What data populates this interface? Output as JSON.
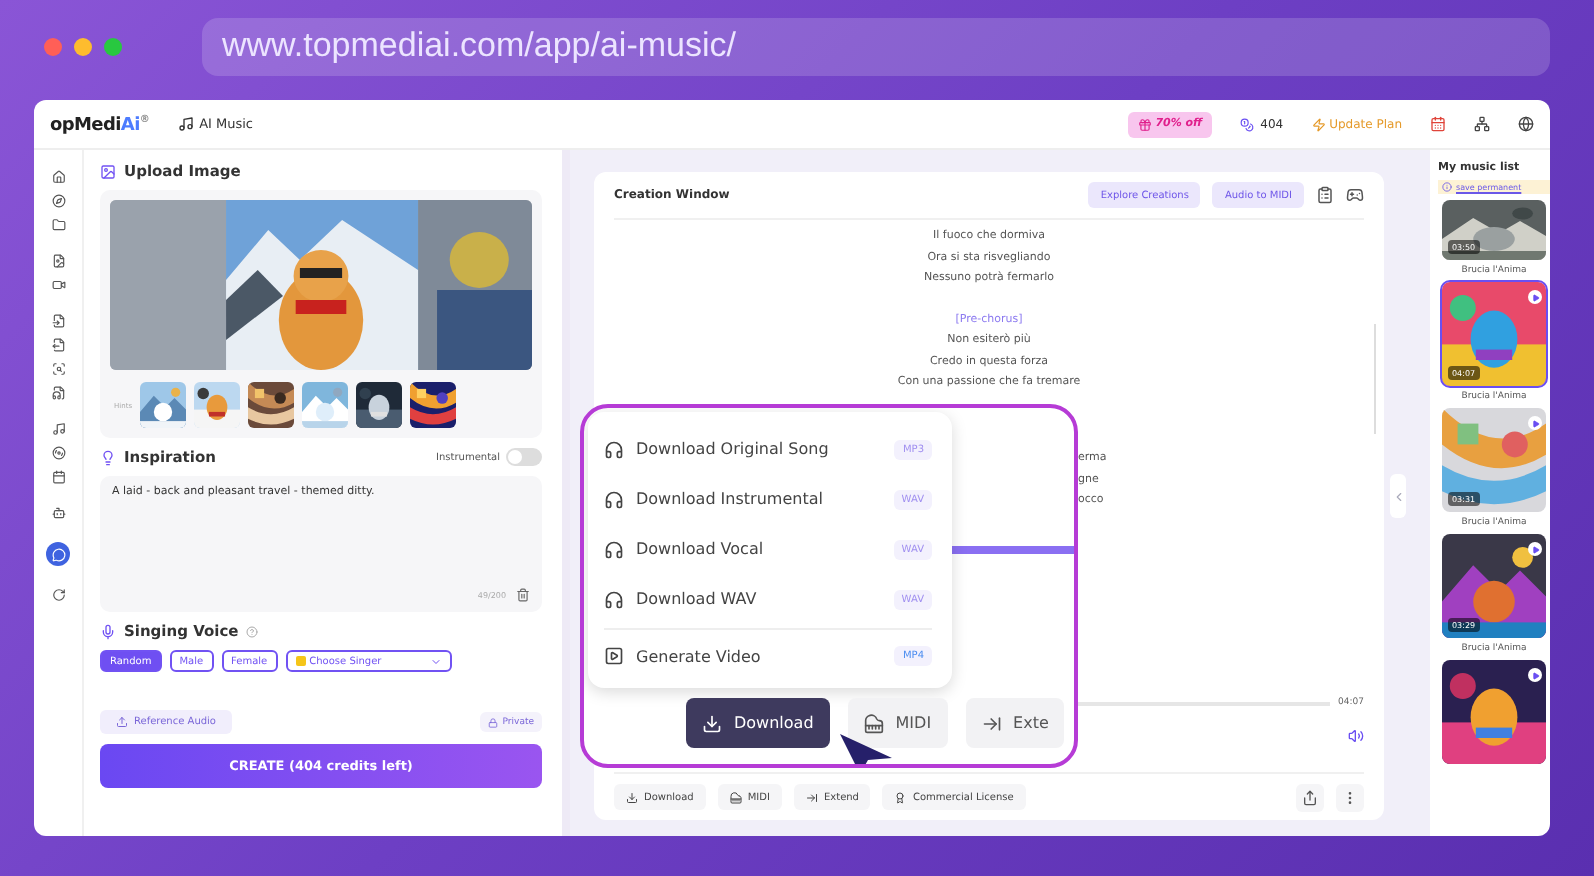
{
  "browser": {
    "url": "www.topmediai.com/app/ai-music/"
  },
  "header": {
    "logo": "opMedi",
    "logo_accent": "Ai",
    "logo_mark": "®",
    "product": "AI Music",
    "promo": "70% off",
    "credits": "404",
    "upgrade": "Update Plan"
  },
  "upload": {
    "title": "Upload Image",
    "hint_label": "Hints"
  },
  "inspiration": {
    "title": "Inspiration",
    "instrumental_label": "Instrumental",
    "instrumental_on": false,
    "text": "A laid - back and pleasant travel - themed ditty.",
    "counter": "49/200"
  },
  "voice": {
    "title": "Singing Voice",
    "options": [
      {
        "label": "Random",
        "selected": true
      },
      {
        "label": "Male",
        "selected": false
      },
      {
        "label": "Female",
        "selected": false
      }
    ],
    "singer_placeholder": "Choose Singer"
  },
  "reference": "Reference Audio",
  "privacy": "Private",
  "create": "CREATE (404 credits left)",
  "creation": {
    "title": "Creation Window",
    "actions": [
      "Explore Creations",
      "Audio to MIDI"
    ],
    "lyrics": [
      {
        "kind": "line",
        "text": "Il fuoco che dormiva"
      },
      {
        "kind": "line",
        "text": "Ora si sta risvegliando"
      },
      {
        "kind": "line",
        "text": "Nessuno potrà fermarlo"
      },
      {
        "kind": "gap"
      },
      {
        "kind": "section",
        "text": "[Pre-chorus]"
      },
      {
        "kind": "line",
        "text": "Non esiterò più"
      },
      {
        "kind": "line",
        "text": "Credo in questa forza"
      },
      {
        "kind": "line",
        "text": "Con una passione che fa tremare"
      }
    ],
    "lyric_fragments": [
      "erma",
      "gne",
      "occo"
    ],
    "time": "04:07",
    "toolbar": [
      {
        "kind": "download",
        "label": "Download"
      },
      {
        "kind": "midi",
        "label": "MIDI"
      },
      {
        "kind": "extend",
        "label": "Extend"
      },
      {
        "kind": "license",
        "label": "Commercial License"
      }
    ]
  },
  "callout": {
    "menu": [
      {
        "kind": "audio",
        "label": "Download Original Song",
        "format": "MP3"
      },
      {
        "kind": "audio",
        "label": "Download Instrumental",
        "format": "WAV"
      },
      {
        "kind": "audio",
        "label": "Download Vocal",
        "format": "WAV"
      },
      {
        "kind": "audio",
        "label": "Download WAV",
        "format": "WAV"
      },
      {
        "kind": "video",
        "label": "Generate Video",
        "format": "MP4"
      }
    ],
    "buttons": [
      {
        "kind": "download",
        "label": "Download",
        "selected": true
      },
      {
        "kind": "midi",
        "label": "MIDI",
        "selected": false
      },
      {
        "kind": "extend",
        "label": "Exte",
        "selected": false
      }
    ]
  },
  "music_list": {
    "title": "My music list",
    "notice": "save permanent",
    "items": [
      {
        "title": "Brucia l'Anima",
        "duration": "03:50"
      },
      {
        "title": "Brucia l'Anima",
        "duration": "04:07",
        "selected": true
      },
      {
        "title": "Brucia l'Anima",
        "duration": "03:31",
        "selected": false
      },
      {
        "title": "Brucia l'Anima",
        "duration": "03:29",
        "selected": false
      },
      {
        "selected": false
      }
    ]
  }
}
